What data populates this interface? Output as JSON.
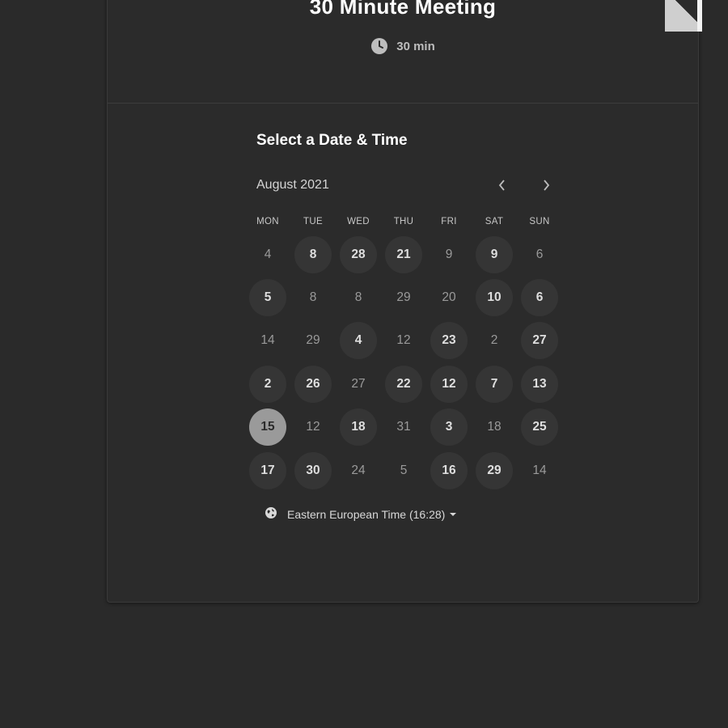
{
  "event": {
    "title": "30 Minute Meeting",
    "duration": "30 min",
    "duration_icon": "clock-icon"
  },
  "calendar": {
    "section_title": "Select a Date & Time",
    "month_label": "August 2021",
    "prev_icon": "chevron-left-icon",
    "next_icon": "chevron-right-icon",
    "weekdays": [
      "MON",
      "TUE",
      "WED",
      "THU",
      "FRI",
      "SAT",
      "SUN"
    ],
    "weeks": [
      [
        {
          "d": "4",
          "s": "unavailable"
        },
        {
          "d": "8",
          "s": "available"
        },
        {
          "d": "28",
          "s": "available"
        },
        {
          "d": "21",
          "s": "available"
        },
        {
          "d": "9",
          "s": "unavailable"
        },
        {
          "d": "9",
          "s": "available"
        },
        {
          "d": "6",
          "s": "unavailable"
        }
      ],
      [
        {
          "d": "5",
          "s": "available"
        },
        {
          "d": "8",
          "s": "unavailable"
        },
        {
          "d": "8",
          "s": "unavailable"
        },
        {
          "d": "29",
          "s": "unavailable"
        },
        {
          "d": "20",
          "s": "unavailable"
        },
        {
          "d": "10",
          "s": "available"
        },
        {
          "d": "6",
          "s": "available"
        }
      ],
      [
        {
          "d": "14",
          "s": "unavailable"
        },
        {
          "d": "29",
          "s": "unavailable"
        },
        {
          "d": "4",
          "s": "available"
        },
        {
          "d": "12",
          "s": "unavailable"
        },
        {
          "d": "23",
          "s": "available"
        },
        {
          "d": "2",
          "s": "unavailable"
        },
        {
          "d": "27",
          "s": "available"
        }
      ],
      [
        {
          "d": "2",
          "s": "available"
        },
        {
          "d": "26",
          "s": "available"
        },
        {
          "d": "27",
          "s": "unavailable"
        },
        {
          "d": "22",
          "s": "available"
        },
        {
          "d": "12",
          "s": "available"
        },
        {
          "d": "7",
          "s": "available"
        },
        {
          "d": "13",
          "s": "available"
        }
      ],
      [
        {
          "d": "15",
          "s": "selected"
        },
        {
          "d": "12",
          "s": "unavailable"
        },
        {
          "d": "18",
          "s": "available"
        },
        {
          "d": "31",
          "s": "unavailable"
        },
        {
          "d": "3",
          "s": "available"
        },
        {
          "d": "18",
          "s": "unavailable"
        },
        {
          "d": "25",
          "s": "available"
        }
      ],
      [
        {
          "d": "17",
          "s": "available"
        },
        {
          "d": "30",
          "s": "available"
        },
        {
          "d": "24",
          "s": "unavailable"
        },
        {
          "d": "5",
          "s": "unavailable"
        },
        {
          "d": "16",
          "s": "available"
        },
        {
          "d": "29",
          "s": "available"
        },
        {
          "d": "14",
          "s": "unavailable"
        }
      ]
    ]
  },
  "timezone": {
    "label": "Eastern European Time (16:28)",
    "icon": "globe-icon"
  },
  "colors": {
    "background": "#2a2a2a",
    "card": "#2b2b2b",
    "available_day": "#353535",
    "selected_day": "#9a9a9a"
  }
}
